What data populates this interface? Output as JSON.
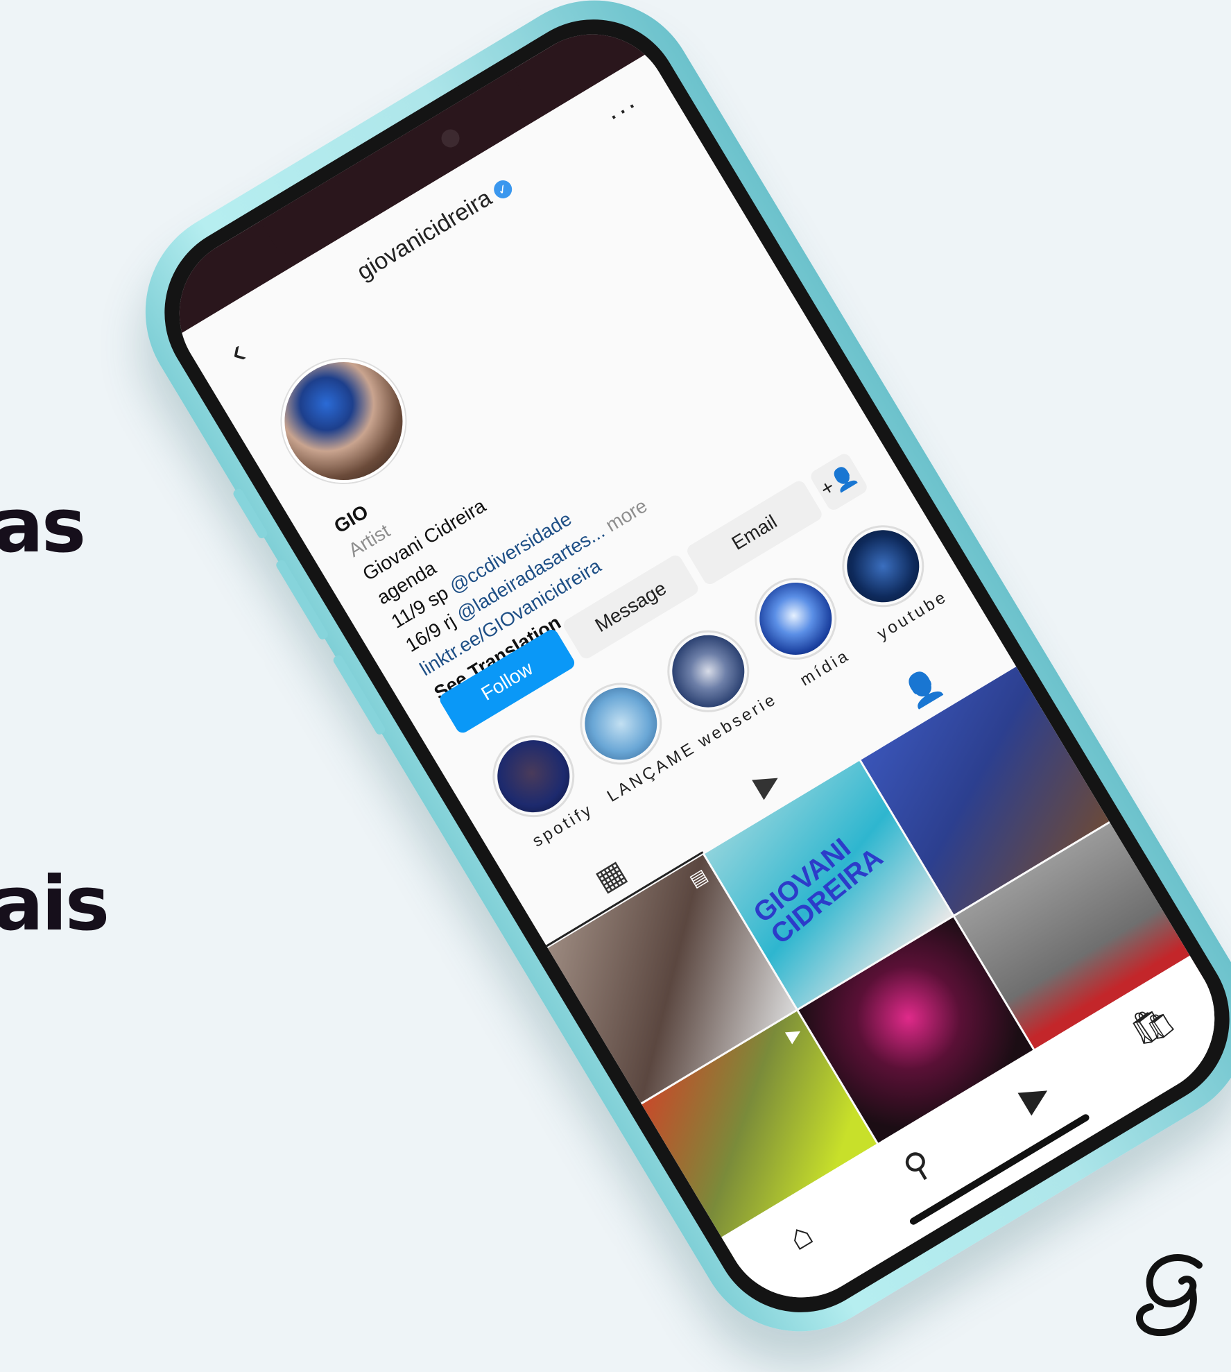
{
  "side_text": {
    "line1": "as",
    "line2": "ais"
  },
  "colors": {
    "accent": "#0a98f7",
    "background": "#eef4f7",
    "phone_body": "#aee6ea"
  },
  "profile": {
    "username": "giovanicidreira",
    "verified_icon": "verified-badge-icon",
    "name": "GIO",
    "category": "Artist",
    "bio_lines": [
      "Giovani Cidreira",
      "agenda"
    ],
    "events": [
      {
        "date": "11/9 sp",
        "mention": "@ccdiversidade"
      },
      {
        "date": "16/9 rj",
        "mention": "@ladeiradasartes...",
        "more": "more"
      }
    ],
    "link": "linktr.ee/GIOvanicidreira",
    "see_translation": "See Translation"
  },
  "buttons": {
    "follow": "Follow",
    "message": "Message",
    "email": "Email",
    "add_user_icon": "add-person-icon"
  },
  "highlights": [
    {
      "label": "spotify",
      "color": "#1d2a6e"
    },
    {
      "label": "LANÇAMEN...",
      "color": "#6aa7d6"
    },
    {
      "label": "webserie",
      "color": "#243a6b"
    },
    {
      "label": "mídia",
      "color": "#1a3f9e"
    },
    {
      "label": "youtube",
      "color": "#0e2a5c"
    }
  ],
  "tabs": [
    {
      "name": "grid-icon",
      "glyph": "▦"
    },
    {
      "name": "reels-icon",
      "glyph": "▶"
    },
    {
      "name": "tagged-icon",
      "glyph": "👤"
    }
  ],
  "grid_posts": [
    {
      "color": "#7f6b62",
      "badge": "▤"
    },
    {
      "color": "#2eb6cf",
      "title": "GIOVANI CIDREIRA"
    },
    {
      "color": "#2c3f8f"
    },
    {
      "color": "#9acb3c",
      "badge": "▶"
    },
    {
      "color": "#1b0d14"
    },
    {
      "color": "#8e8e8e"
    }
  ],
  "nav": [
    {
      "name": "home-icon",
      "glyph": "⌂"
    },
    {
      "name": "search-icon",
      "glyph": "⚲"
    },
    {
      "name": "reels-nav-icon",
      "glyph": "▶"
    },
    {
      "name": "shop-icon",
      "glyph": "🛍"
    }
  ]
}
